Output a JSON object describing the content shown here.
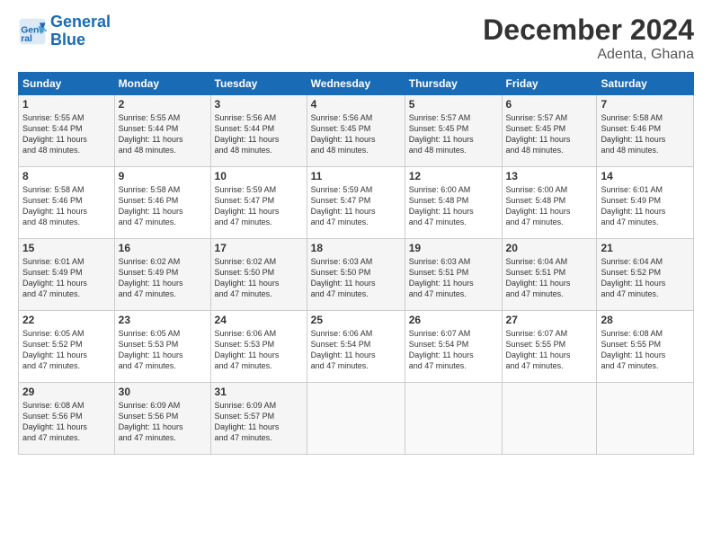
{
  "logo": {
    "text_general": "General",
    "text_blue": "Blue"
  },
  "header": {
    "month_title": "December 2024",
    "location": "Adenta, Ghana"
  },
  "calendar": {
    "days_of_week": [
      "Sunday",
      "Monday",
      "Tuesday",
      "Wednesday",
      "Thursday",
      "Friday",
      "Saturday"
    ],
    "weeks": [
      [
        {
          "day": "1",
          "sunrise": "5:55 AM",
          "sunset": "5:44 PM",
          "daylight": "11 hours and 48 minutes."
        },
        {
          "day": "2",
          "sunrise": "5:55 AM",
          "sunset": "5:44 PM",
          "daylight": "11 hours and 48 minutes."
        },
        {
          "day": "3",
          "sunrise": "5:56 AM",
          "sunset": "5:44 PM",
          "daylight": "11 hours and 48 minutes."
        },
        {
          "day": "4",
          "sunrise": "5:56 AM",
          "sunset": "5:45 PM",
          "daylight": "11 hours and 48 minutes."
        },
        {
          "day": "5",
          "sunrise": "5:57 AM",
          "sunset": "5:45 PM",
          "daylight": "11 hours and 48 minutes."
        },
        {
          "day": "6",
          "sunrise": "5:57 AM",
          "sunset": "5:45 PM",
          "daylight": "11 hours and 48 minutes."
        },
        {
          "day": "7",
          "sunrise": "5:58 AM",
          "sunset": "5:46 PM",
          "daylight": "11 hours and 48 minutes."
        }
      ],
      [
        {
          "day": "8",
          "sunrise": "5:58 AM",
          "sunset": "5:46 PM",
          "daylight": "11 hours and 48 minutes."
        },
        {
          "day": "9",
          "sunrise": "5:58 AM",
          "sunset": "5:46 PM",
          "daylight": "11 hours and 47 minutes."
        },
        {
          "day": "10",
          "sunrise": "5:59 AM",
          "sunset": "5:47 PM",
          "daylight": "11 hours and 47 minutes."
        },
        {
          "day": "11",
          "sunrise": "5:59 AM",
          "sunset": "5:47 PM",
          "daylight": "11 hours and 47 minutes."
        },
        {
          "day": "12",
          "sunrise": "6:00 AM",
          "sunset": "5:48 PM",
          "daylight": "11 hours and 47 minutes."
        },
        {
          "day": "13",
          "sunrise": "6:00 AM",
          "sunset": "5:48 PM",
          "daylight": "11 hours and 47 minutes."
        },
        {
          "day": "14",
          "sunrise": "6:01 AM",
          "sunset": "5:49 PM",
          "daylight": "11 hours and 47 minutes."
        }
      ],
      [
        {
          "day": "15",
          "sunrise": "6:01 AM",
          "sunset": "5:49 PM",
          "daylight": "11 hours and 47 minutes."
        },
        {
          "day": "16",
          "sunrise": "6:02 AM",
          "sunset": "5:49 PM",
          "daylight": "11 hours and 47 minutes."
        },
        {
          "day": "17",
          "sunrise": "6:02 AM",
          "sunset": "5:50 PM",
          "daylight": "11 hours and 47 minutes."
        },
        {
          "day": "18",
          "sunrise": "6:03 AM",
          "sunset": "5:50 PM",
          "daylight": "11 hours and 47 minutes."
        },
        {
          "day": "19",
          "sunrise": "6:03 AM",
          "sunset": "5:51 PM",
          "daylight": "11 hours and 47 minutes."
        },
        {
          "day": "20",
          "sunrise": "6:04 AM",
          "sunset": "5:51 PM",
          "daylight": "11 hours and 47 minutes."
        },
        {
          "day": "21",
          "sunrise": "6:04 AM",
          "sunset": "5:52 PM",
          "daylight": "11 hours and 47 minutes."
        }
      ],
      [
        {
          "day": "22",
          "sunrise": "6:05 AM",
          "sunset": "5:52 PM",
          "daylight": "11 hours and 47 minutes."
        },
        {
          "day": "23",
          "sunrise": "6:05 AM",
          "sunset": "5:53 PM",
          "daylight": "11 hours and 47 minutes."
        },
        {
          "day": "24",
          "sunrise": "6:06 AM",
          "sunset": "5:53 PM",
          "daylight": "11 hours and 47 minutes."
        },
        {
          "day": "25",
          "sunrise": "6:06 AM",
          "sunset": "5:54 PM",
          "daylight": "11 hours and 47 minutes."
        },
        {
          "day": "26",
          "sunrise": "6:07 AM",
          "sunset": "5:54 PM",
          "daylight": "11 hours and 47 minutes."
        },
        {
          "day": "27",
          "sunrise": "6:07 AM",
          "sunset": "5:55 PM",
          "daylight": "11 hours and 47 minutes."
        },
        {
          "day": "28",
          "sunrise": "6:08 AM",
          "sunset": "5:55 PM",
          "daylight": "11 hours and 47 minutes."
        }
      ],
      [
        {
          "day": "29",
          "sunrise": "6:08 AM",
          "sunset": "5:56 PM",
          "daylight": "11 hours and 47 minutes."
        },
        {
          "day": "30",
          "sunrise": "6:09 AM",
          "sunset": "5:56 PM",
          "daylight": "11 hours and 47 minutes."
        },
        {
          "day": "31",
          "sunrise": "6:09 AM",
          "sunset": "5:57 PM",
          "daylight": "11 hours and 47 minutes."
        },
        null,
        null,
        null,
        null
      ]
    ]
  }
}
